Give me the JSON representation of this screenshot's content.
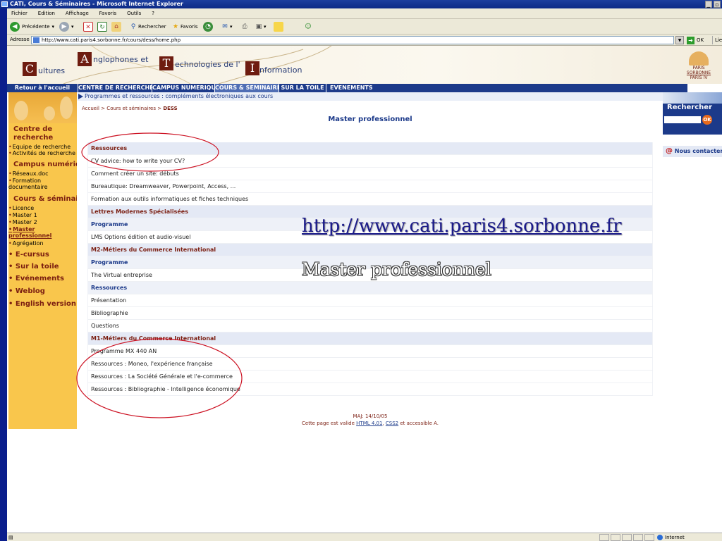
{
  "window": {
    "title": "CATI, Cours & Séminaires - Microsoft Internet Explorer"
  },
  "menu": [
    "Fichier",
    "Edition",
    "Affichage",
    "Favoris",
    "Outils",
    "?"
  ],
  "toolbar": {
    "back": "Précédente",
    "search": "Rechercher",
    "favorites": "Favoris"
  },
  "address": {
    "label": "Adresse",
    "url": "http://www.cati.paris4.sorbonne.fr/cours/dess/home.php",
    "go": "OK",
    "links": "Liens"
  },
  "banner": {
    "letter_c": "C",
    "word_c": "ultures",
    "letter_a": "A",
    "word_a": "nglophones et",
    "letter_t": "T",
    "word_t": "echnologies de l'",
    "letter_i": "I",
    "word_i": "nformation",
    "sorbonne_top": "PARIS",
    "sorbonne_name": "SORBONNE",
    "sorbonne_sub": "PARIS IV"
  },
  "nav": {
    "home": "Retour à l'accueil",
    "items": [
      "CENTRE DE RECHERCHE",
      "CAMPUS NUMERIQUE",
      "COURS & SEMINAIRES",
      "SUR LA TOILE",
      "EVENEMENTS"
    ]
  },
  "sidebar": {
    "centre_title": "Centre de recherche",
    "centre_items": [
      "Equipe de recherche",
      "Activités de recherche"
    ],
    "campus_title": "Campus numérique",
    "campus_items": [
      "Réseaux.doc",
      "Formation documentaire"
    ],
    "cours_title": "Cours & séminaires",
    "cours_items": [
      "Licence",
      "Master 1",
      "Master 2",
      "Master professionnel",
      "Agrégation"
    ],
    "bottom_items": [
      "E-cursus",
      "Sur la toile",
      "Evénements",
      "Weblog",
      "English version"
    ]
  },
  "subnav": "Programmes et ressources : compléments électroniques aux cours",
  "breadcrumb": {
    "trail": "Accueil > Cours et séminaires > ",
    "current": "DESS"
  },
  "page_title": "Master professionnel",
  "rows": [
    {
      "type": "hdr",
      "text": "Ressources"
    },
    {
      "type": "item",
      "text": "CV advice: how to write your CV?"
    },
    {
      "type": "item",
      "text": "Comment créer un site: débuts"
    },
    {
      "type": "item",
      "text": "Bureautique: Dreamweaver, Powerpoint, Access, ..."
    },
    {
      "type": "item",
      "text": "Formation aux outils informatiques et fiches techniques"
    },
    {
      "type": "hdr",
      "text": "Lettres Modernes Spécialisées"
    },
    {
      "type": "sub",
      "text": "Programme"
    },
    {
      "type": "item",
      "text": "LMS Options édition et audio-visuel"
    },
    {
      "type": "hdr",
      "text": "M2-Métiers du Commerce International"
    },
    {
      "type": "sub",
      "text": "Programme"
    },
    {
      "type": "item",
      "text": "The Virtual entreprise"
    },
    {
      "type": "sub",
      "text": "Ressources"
    },
    {
      "type": "item",
      "text": "Présentation"
    },
    {
      "type": "item",
      "text": "Bibliographie"
    },
    {
      "type": "item",
      "text": "Questions"
    },
    {
      "type": "hdr",
      "text": "M1-Métiers du Commerce International"
    },
    {
      "type": "item",
      "text": "Programme MX 440 AN"
    },
    {
      "type": "item",
      "text": "Ressources : Moneo, l'expérience française"
    },
    {
      "type": "item",
      "text": "Ressources : La Société Générale et l'e-commerce"
    },
    {
      "type": "item",
      "text": "Ressources : Bibliographie - Intelligence économique"
    }
  ],
  "footer": {
    "maj": "MAJ: 14/10/05",
    "valid_pre": "Cette page est valide ",
    "html": "HTML 4.01",
    "sep": ", ",
    "css": "CSS2",
    "valid_post": " et accessible A."
  },
  "right": {
    "search_title": "Rechercher",
    "ok": "OK",
    "contact": "Nous contacter"
  },
  "overlay": {
    "url": "http://www.cati.paris4.sorbonne.fr",
    "subtitle": "Master professionnel"
  },
  "status": {
    "zone": "Internet"
  },
  "colors": {
    "navy": "#1c3a8a",
    "maroon": "#7a1d10",
    "sidebar": "#f9c64c",
    "annotation": "#cc1122"
  }
}
